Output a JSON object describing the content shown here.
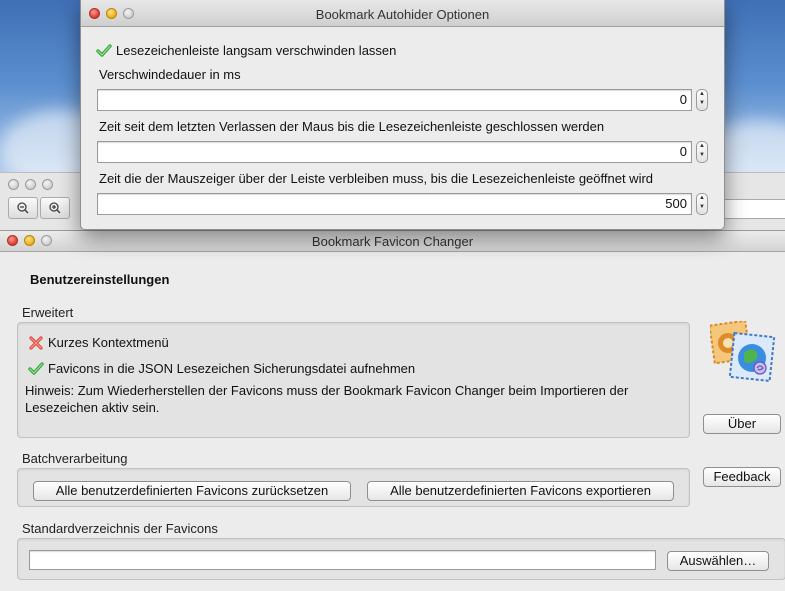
{
  "dialog": {
    "title": "Bookmark Autohider Optionen",
    "checkbox_label": "Lesezeichenleiste langsam verschwinden lassen",
    "fields": [
      {
        "label": "Verschwindedauer in ms",
        "value": "0"
      },
      {
        "label": "Zeit seit dem letzten Verlassen der Maus bis die Lesezeichenleiste geschlossen werden",
        "value": "0"
      },
      {
        "label": "Zeit die der Mauszeiger über der Leiste verbleiben muss, bis die Lesezeichenleiste geöffnet wird",
        "value": "500"
      }
    ]
  },
  "main": {
    "title": "Bookmark Favicon Changer",
    "heading": "Benutzereinstellungen",
    "advanced": {
      "label": "Erweitert",
      "option1": "Kurzes Kontextmenü",
      "option2": "Favicons in die JSON Lesezeichen Sicherungsdatei aufnehmen",
      "hint_line1": "Hinweis: Zum Wiederherstellen der Favicons muss der Bookmark Favicon Changer beim Importieren der",
      "hint_line2": "Lesezeichen aktiv sein."
    },
    "batch": {
      "label": "Batchverarbeitung",
      "reset_button": "Alle benutzerdefinierten Favicons zurücksetzen",
      "export_button": "Alle benutzerdefinierten Favicons exportieren"
    },
    "directory": {
      "label": "Standardverzeichnis der Favicons",
      "value": "",
      "choose_button": "Auswählen…"
    },
    "about_button": "Über",
    "feedback_button": "Feedback"
  },
  "colors": {
    "check_green": "#3aa83a",
    "cross_red": "#e0443a"
  }
}
